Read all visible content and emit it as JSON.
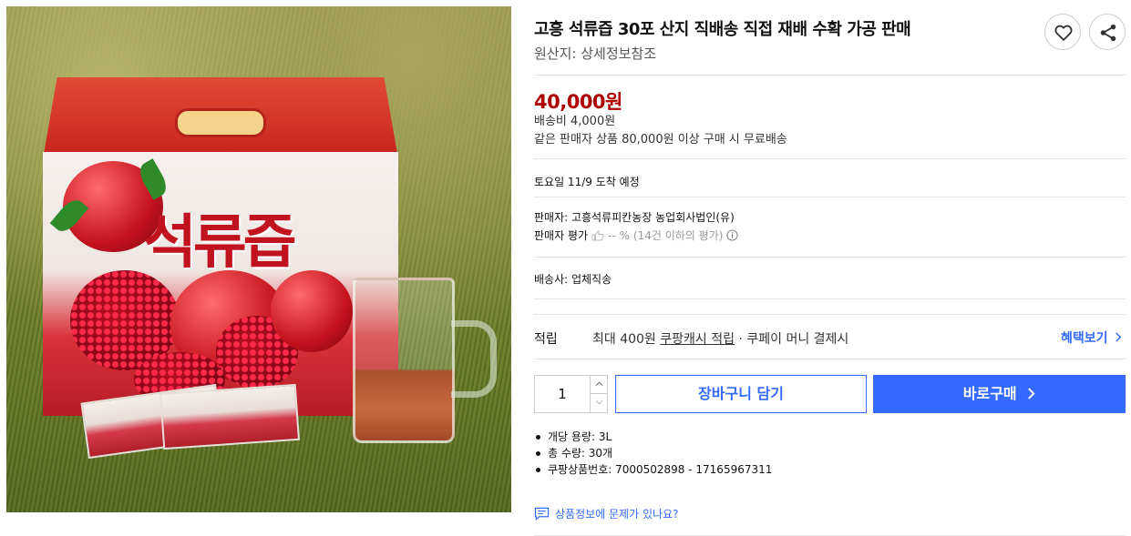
{
  "image": {
    "alt": "고흥 석류즙 30포 제품 사진",
    "box_title": "석류즙"
  },
  "product": {
    "title": "고흥 석류즙 30포 산지 직배송 직접 재배 수확 가공 판매",
    "origin": "원산지: 상세정보참조"
  },
  "actions": {
    "wish_icon": "heart-icon",
    "share_icon": "share-icon"
  },
  "price": {
    "value": "40,000원",
    "shipping_fee": "배송비 4,000원",
    "free_shipping": "같은 판매자 상품 80,000원 이상 구매 시 무료배송"
  },
  "delivery": {
    "arrival": "토요일 11/9 도착 예정"
  },
  "seller": {
    "name": "판매자: 고흥석류피칸농장 농업회사법인(유)",
    "rating_label": "판매자 평가",
    "rating_value": "-- %",
    "rating_note": "(14건 이하의 평가)"
  },
  "shipping": {
    "carrier": "배송사: 업체직송"
  },
  "points": {
    "label": "적립",
    "prefix": "최대 400원 ",
    "link": "쿠팡캐시 적립",
    "suffix": " · 쿠페이 머니 결제시",
    "benefit": "혜택보기"
  },
  "purchase": {
    "quantity": "1",
    "cart_label": "장바구니 담기",
    "buy_label": "바로구매"
  },
  "specs": {
    "volume": "개당 용량: 3L",
    "count": "총 수량: 30개",
    "product_no": "쿠팡상품번호: 7000502898 - 17165967311"
  },
  "report": {
    "label": "상품정보에 문제가 있나요?"
  },
  "colors": {
    "accent": "#346aff",
    "price": "#ae0000"
  }
}
